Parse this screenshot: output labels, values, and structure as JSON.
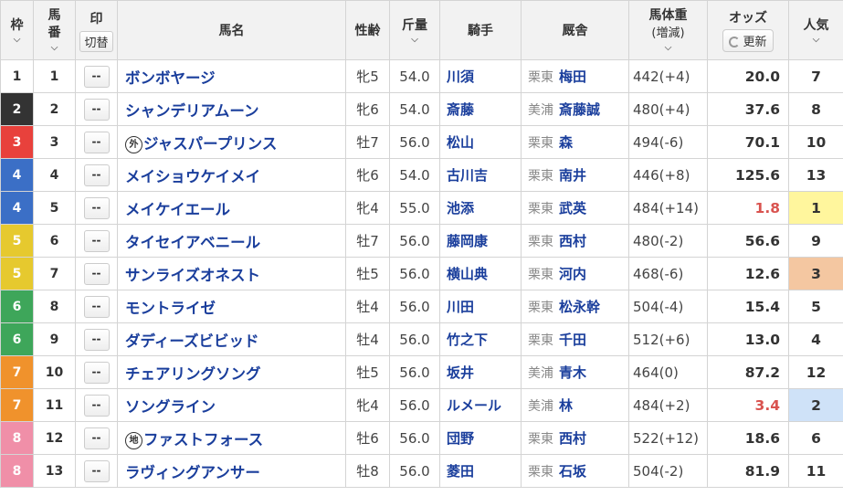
{
  "headers": {
    "frame": "枠",
    "number_line1": "馬",
    "number_line2": "番",
    "mark": "印",
    "mark_switch": "切替",
    "horse_name": "馬名",
    "sex_age": "性齢",
    "weight": "斤量",
    "jockey": "騎手",
    "stable": "厩舎",
    "body_weight": "馬体重",
    "body_weight_sub": "(増減)",
    "odds": "オッズ",
    "refresh": "更新",
    "popularity": "人気"
  },
  "mark_placeholder": "--",
  "frame_colors": {
    "1": {
      "bg": "#ffffff",
      "fg": "#333333"
    },
    "2": {
      "bg": "#333333",
      "fg": "#ffffff"
    },
    "3": {
      "bg": "#e8413c",
      "fg": "#ffffff"
    },
    "4": {
      "bg": "#3b6fc6",
      "fg": "#ffffff"
    },
    "5": {
      "bg": "#e6c92e",
      "fg": "#ffffff"
    },
    "6": {
      "bg": "#3ea65a",
      "fg": "#ffffff"
    },
    "7": {
      "bg": "#f0922c",
      "fg": "#ffffff"
    },
    "8": {
      "bg": "#f08fa8",
      "fg": "#ffffff"
    }
  },
  "rows": [
    {
      "frame": "1",
      "number": "1",
      "badge": "",
      "name": "ボンボヤージ",
      "sex_age": "牝5",
      "weight": "54.0",
      "jockey": "川須",
      "region": "栗東",
      "trainer": "梅田",
      "body": "442(+4)",
      "odds": "20.0",
      "popularity": "7"
    },
    {
      "frame": "2",
      "number": "2",
      "badge": "",
      "name": "シャンデリアムーン",
      "sex_age": "牝6",
      "weight": "54.0",
      "jockey": "斎藤",
      "region": "美浦",
      "trainer": "斎藤誠",
      "body": "480(+4)",
      "odds": "37.6",
      "popularity": "8"
    },
    {
      "frame": "3",
      "number": "3",
      "badge": "外",
      "name": "ジャスパープリンス",
      "sex_age": "牡7",
      "weight": "56.0",
      "jockey": "松山",
      "region": "栗東",
      "trainer": "森",
      "body": "494(-6)",
      "odds": "70.1",
      "popularity": "10"
    },
    {
      "frame": "4",
      "number": "4",
      "badge": "",
      "name": "メイショウケイメイ",
      "sex_age": "牝6",
      "weight": "54.0",
      "jockey": "古川吉",
      "region": "栗東",
      "trainer": "南井",
      "body": "446(+8)",
      "odds": "125.6",
      "popularity": "13"
    },
    {
      "frame": "4",
      "number": "5",
      "badge": "",
      "name": "メイケイエール",
      "sex_age": "牝4",
      "weight": "55.0",
      "jockey": "池添",
      "region": "栗東",
      "trainer": "武英",
      "body": "484(+14)",
      "odds": "1.8",
      "popularity": "1"
    },
    {
      "frame": "5",
      "number": "6",
      "badge": "",
      "name": "タイセイアベニール",
      "sex_age": "牡7",
      "weight": "56.0",
      "jockey": "藤岡康",
      "region": "栗東",
      "trainer": "西村",
      "body": "480(-2)",
      "odds": "56.6",
      "popularity": "9"
    },
    {
      "frame": "5",
      "number": "7",
      "badge": "",
      "name": "サンライズオネスト",
      "sex_age": "牡5",
      "weight": "56.0",
      "jockey": "横山典",
      "region": "栗東",
      "trainer": "河内",
      "body": "468(-6)",
      "odds": "12.6",
      "popularity": "3"
    },
    {
      "frame": "6",
      "number": "8",
      "badge": "",
      "name": "モントライゼ",
      "sex_age": "牡4",
      "weight": "56.0",
      "jockey": "川田",
      "region": "栗東",
      "trainer": "松永幹",
      "body": "504(-4)",
      "odds": "15.4",
      "popularity": "5"
    },
    {
      "frame": "6",
      "number": "9",
      "badge": "",
      "name": "ダディーズビビッド",
      "sex_age": "牡4",
      "weight": "56.0",
      "jockey": "竹之下",
      "region": "栗東",
      "trainer": "千田",
      "body": "512(+6)",
      "odds": "13.0",
      "popularity": "4"
    },
    {
      "frame": "7",
      "number": "10",
      "badge": "",
      "name": "チェアリングソング",
      "sex_age": "牡5",
      "weight": "56.0",
      "jockey": "坂井",
      "region": "美浦",
      "trainer": "青木",
      "body": "464(0)",
      "odds": "87.2",
      "popularity": "12"
    },
    {
      "frame": "7",
      "number": "11",
      "badge": "",
      "name": "ソングライン",
      "sex_age": "牝4",
      "weight": "56.0",
      "jockey": "ルメール",
      "region": "美浦",
      "trainer": "林",
      "body": "484(+2)",
      "odds": "3.4",
      "popularity": "2"
    },
    {
      "frame": "8",
      "number": "12",
      "badge": "地",
      "name": "ファストフォース",
      "sex_age": "牡6",
      "weight": "56.0",
      "jockey": "団野",
      "region": "栗東",
      "trainer": "西村",
      "body": "522(+12)",
      "odds": "18.6",
      "popularity": "6"
    },
    {
      "frame": "8",
      "number": "13",
      "badge": "",
      "name": "ラヴィングアンサー",
      "sex_age": "牡8",
      "weight": "56.0",
      "jockey": "菱田",
      "region": "栗東",
      "trainer": "石坂",
      "body": "504(-2)",
      "odds": "81.9",
      "popularity": "11"
    }
  ]
}
